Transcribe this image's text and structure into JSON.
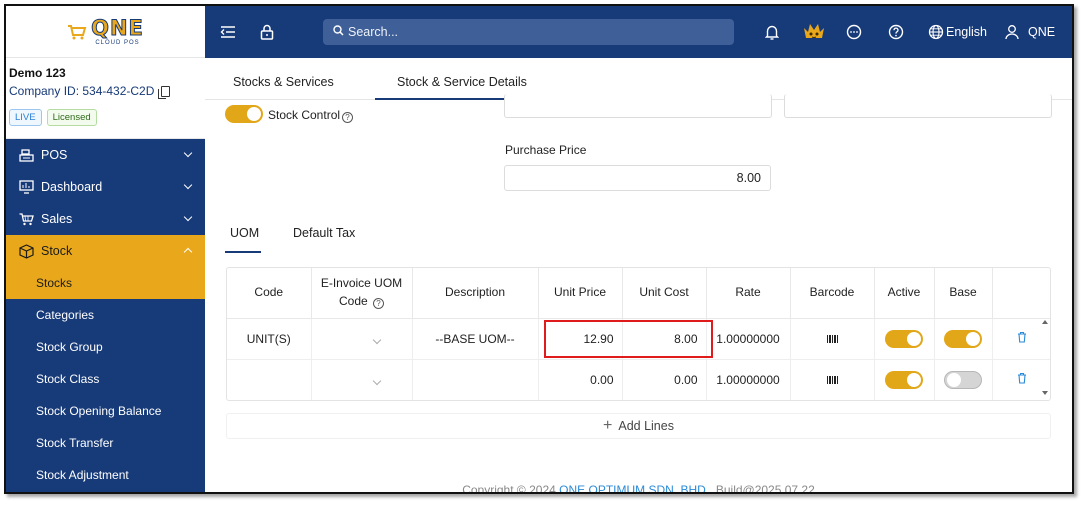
{
  "logo": {
    "brand": "QNE",
    "sub": "CLOUD POS"
  },
  "company": {
    "name": "Demo 123",
    "id": "Company ID: 534-432-C2D",
    "badges": [
      "LIVE",
      "Licensed"
    ]
  },
  "sidebar": {
    "items": [
      {
        "label": "POS",
        "icon": "register-icon"
      },
      {
        "label": "Dashboard",
        "icon": "chart-monitor-icon"
      },
      {
        "label": "Sales",
        "icon": "cart-icon"
      },
      {
        "label": "Stock",
        "icon": "cube-icon"
      }
    ],
    "stock_sub": [
      "Stocks",
      "Categories",
      "Stock Group",
      "Stock Class",
      "Stock Opening Balance",
      "Stock Transfer",
      "Stock Adjustment"
    ]
  },
  "topbar": {
    "search_placeholder": "Search...",
    "language": "English",
    "user": "QNE"
  },
  "tabs": [
    "Stocks & Services",
    "Stock & Service Details"
  ],
  "form": {
    "stock_control_label": "Stock Control",
    "purchase_price_label": "Purchase Price",
    "purchase_price": "8.00"
  },
  "uom_tabs": [
    "UOM",
    "Default Tax"
  ],
  "grid": {
    "headers": [
      "Code",
      "E-Invoice UOM",
      "Code",
      "Description",
      "Unit Price",
      "Unit Cost",
      "Rate",
      "Barcode",
      "Active",
      "Base"
    ],
    "rows": [
      {
        "code": "UNIT(S)",
        "einv": "",
        "description": "--BASE UOM--",
        "unit_price": "12.90",
        "unit_cost": "8.00",
        "rate": "1.00000000",
        "active": true,
        "base": true
      },
      {
        "code": "",
        "einv": "",
        "description": "",
        "unit_price": "0.00",
        "unit_cost": "0.00",
        "rate": "1.00000000",
        "active": true,
        "base": false
      }
    ]
  },
  "add_lines": "Add Lines",
  "footer": {
    "prefix": "Copyright",
    "year": "2024",
    "company": "QNE OPTIMUM SDN. BHD.",
    "build": "Build@2025.07.22"
  },
  "colors": {
    "navy": "#173a78",
    "accent": "#e9a81c",
    "highlight": "#e01b1b",
    "link": "#2a8ad7"
  }
}
